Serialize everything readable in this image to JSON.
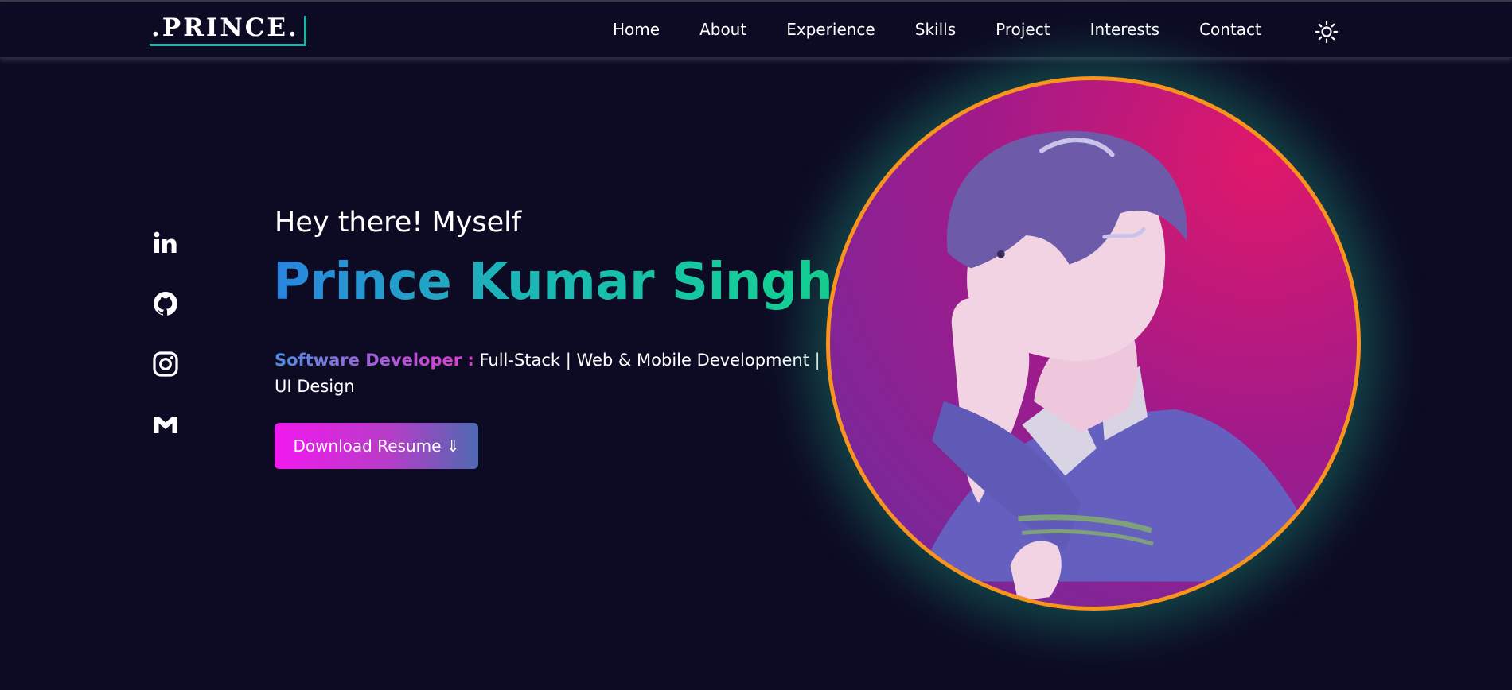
{
  "brand": {
    "logo_text": ".PRINCE."
  },
  "nav": {
    "items": [
      {
        "label": "Home"
      },
      {
        "label": "About"
      },
      {
        "label": "Experience"
      },
      {
        "label": "Skills"
      },
      {
        "label": "Project"
      },
      {
        "label": "Interests"
      },
      {
        "label": "Contact"
      }
    ],
    "theme_toggle_icon": "sun-icon"
  },
  "socials": [
    {
      "icon": "linkedin-icon"
    },
    {
      "icon": "github-icon"
    },
    {
      "icon": "instagram-icon"
    },
    {
      "icon": "gmail-icon"
    }
  ],
  "hero": {
    "greeting": "Hey there! Myself",
    "name": "Prince Kumar Singh.",
    "role": "Software Developer :",
    "description": " Full-Stack | Web & Mobile Development | UI Design",
    "resume_button": "Download Resume ⇓"
  },
  "colors": {
    "background": "#0d0b24",
    "accent_teal": "#20b2aa",
    "avatar_border": "#f7941d",
    "name_gradient_start": "#2a84e0",
    "name_gradient_end": "#12d68e",
    "button_gradient_start": "#f218f0",
    "button_gradient_end": "#4f6ab2"
  }
}
